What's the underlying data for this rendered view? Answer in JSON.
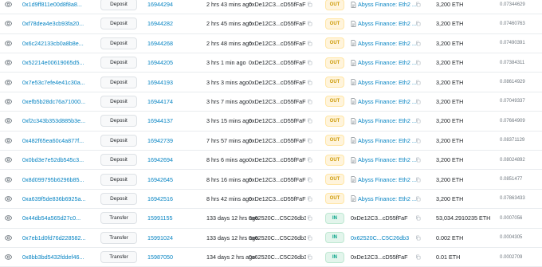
{
  "transactions": [
    {
      "hash": "0x1d9ff811e00d8f8a8...",
      "method": "Deposit",
      "block": "16944294",
      "age": "2 hrs 43 mins ago",
      "from": "0xDe12C3...cD55fFaF",
      "direction": "OUT",
      "to": "Abyss Finance: Eth2 ...",
      "to_type": "contract",
      "value": "3,200 ETH",
      "fee": "0.07344629"
    },
    {
      "hash": "0xf78dea4e3cb93fa20...",
      "method": "Deposit",
      "block": "16944282",
      "age": "2 hrs 45 mins ago",
      "from": "0xDe12C3...cD55fFaF",
      "direction": "OUT",
      "to": "Abyss Finance: Eth2 ...",
      "to_type": "contract",
      "value": "3,200 ETH",
      "fee": "0.07460763"
    },
    {
      "hash": "0x6c242133cb0a8b8e...",
      "method": "Deposit",
      "block": "16944268",
      "age": "2 hrs 48 mins ago",
      "from": "0xDe12C3...cD55fFaF",
      "direction": "OUT",
      "to": "Abyss Finance: Eth2 ...",
      "to_type": "contract",
      "value": "3,200 ETH",
      "fee": "0.07490391"
    },
    {
      "hash": "0x52214e00619065d5...",
      "method": "Deposit",
      "block": "16944205",
      "age": "3 hrs 1 min ago",
      "from": "0xDe12C3...cD55fFaF",
      "direction": "OUT",
      "to": "Abyss Finance: Eth2 ...",
      "to_type": "contract",
      "value": "3,200 ETH",
      "fee": "0.07384311"
    },
    {
      "hash": "0x7e53c7efe4e41c30a...",
      "method": "Deposit",
      "block": "16944193",
      "age": "3 hrs 3 mins ago",
      "from": "0xDe12C3...cD55fFaF",
      "direction": "OUT",
      "to": "Abyss Finance: Eth2 ...",
      "to_type": "contract",
      "value": "3,200 ETH",
      "fee": "0.08614929"
    },
    {
      "hash": "0xefb5b28dc76a71000...",
      "method": "Deposit",
      "block": "16944174",
      "age": "3 hrs 7 mins ago",
      "from": "0xDe12C3...cD55fFaF",
      "direction": "OUT",
      "to": "Abyss Finance: Eth2 ...",
      "to_type": "contract",
      "value": "3,200 ETH",
      "fee": "0.07049337"
    },
    {
      "hash": "0xf2c343b353d885b3e...",
      "method": "Deposit",
      "block": "16944137",
      "age": "3 hrs 15 mins ago",
      "from": "0xDe12C3...cD55fFaF",
      "direction": "OUT",
      "to": "Abyss Finance: Eth2 ...",
      "to_type": "contract",
      "value": "3,200 ETH",
      "fee": "0.07664909"
    },
    {
      "hash": "0x482f65ea60c4a877f...",
      "method": "Deposit",
      "block": "16942739",
      "age": "7 hrs 57 mins ago",
      "from": "0xDe12C3...cD55fFaF",
      "direction": "OUT",
      "to": "Abyss Finance: Eth2 ...",
      "to_type": "contract",
      "value": "3,200 ETH",
      "fee": "0.08371129"
    },
    {
      "hash": "0x0bd3e7e52db545c3...",
      "method": "Deposit",
      "block": "16942694",
      "age": "8 hrs 6 mins ago",
      "from": "0xDe12C3...cD55fFaF",
      "direction": "OUT",
      "to": "Abyss Finance: Eth2 ...",
      "to_type": "contract",
      "value": "3,200 ETH",
      "fee": "0.08024892"
    },
    {
      "hash": "0x8d099795b6296b85...",
      "method": "Deposit",
      "block": "16942645",
      "age": "8 hrs 16 mins ago",
      "from": "0xDe12C3...cD55fFaF",
      "direction": "OUT",
      "to": "Abyss Finance: Eth2 ...",
      "to_type": "contract",
      "value": "3,200 ETH",
      "fee": "0.0851477"
    },
    {
      "hash": "0xa639f5de836b6925a...",
      "method": "Deposit",
      "block": "16942516",
      "age": "8 hrs 42 mins ago",
      "from": "0xDe12C3...cD55fFaF",
      "direction": "OUT",
      "to": "Abyss Finance: Eth2 ...",
      "to_type": "contract",
      "value": "3,200 ETH",
      "fee": "0.07863433"
    },
    {
      "hash": "0x44db54a565d27c0...",
      "method": "Transfer",
      "block": "15991155",
      "age": "133 days 12 hrs ago",
      "from": "0x62520C...C5C26db3",
      "direction": "IN",
      "to": "0xDe12C3...cD55fFaF",
      "to_type": "plain",
      "value": "53,034.2910235 ETH",
      "fee": "0.0007056"
    },
    {
      "hash": "0x7eb1d0fd76d228582...",
      "method": "Transfer",
      "block": "15991024",
      "age": "133 days 12 hrs ago",
      "from": "0x62520C...C5C26db3",
      "direction": "IN",
      "to": "0x62520C...C5C26db3",
      "to_type": "link",
      "value": "0.002 ETH",
      "fee": "0.0004305"
    },
    {
      "hash": "0x8bb3bd5432fddef46...",
      "method": "Transfer",
      "block": "15987050",
      "age": "134 days 2 hrs ago",
      "from": "0x62520C...C5C26db3",
      "direction": "IN",
      "to": "0xDe12C3...cD55fFaF",
      "to_type": "plain",
      "value": "0.01 ETH",
      "fee": "0.0002709"
    }
  ]
}
